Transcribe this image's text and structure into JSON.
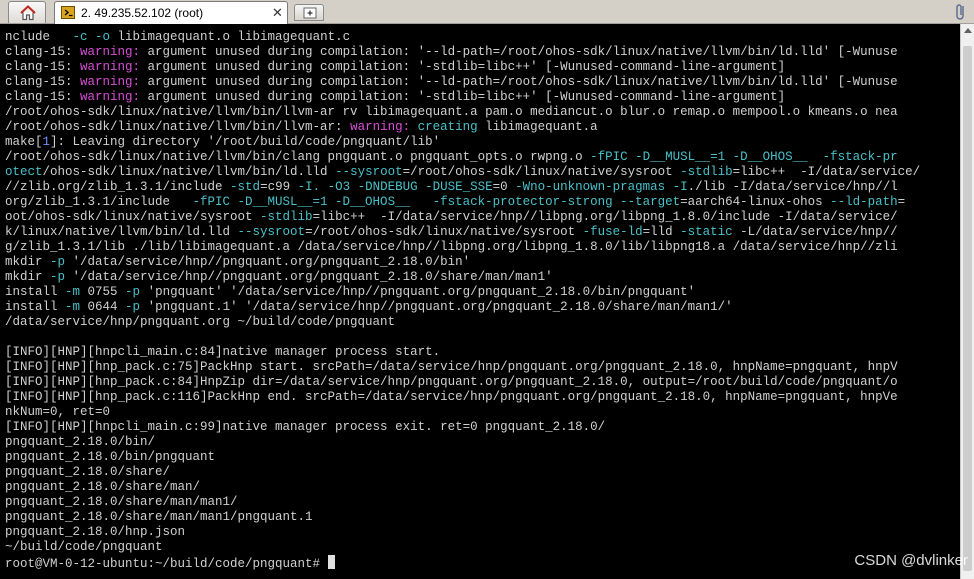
{
  "window": {
    "tab_title": "2. 49.235.52.102 (root)",
    "tab_close_glyph": "✕",
    "home_icon": "home-icon",
    "new_tab_icon": "new-tab-icon",
    "attach_icon": "paperclip-icon"
  },
  "colors": {
    "background": "#000000",
    "warning": "#d84ed6",
    "option": "#4ac0c8",
    "number": "#6f8cff",
    "text": "#d0d0d0"
  },
  "terminal": {
    "prompt": "root@VM-0-12-ubuntu:~/build/code/pngquant#",
    "lines": [
      [
        [
          "nclude   ",
          "n"
        ],
        [
          "-c -o",
          "c"
        ],
        [
          " libimagequant.o libimagequant.c",
          "n"
        ]
      ],
      [
        [
          "clang-15: ",
          "n"
        ],
        [
          "warning:",
          "w"
        ],
        [
          " argument unused during compilation: '--ld-path=/root/ohos-sdk/linux/native/llvm/bin/ld.lld' [-Wunuse",
          "n"
        ]
      ],
      [
        [
          "clang-15: ",
          "n"
        ],
        [
          "warning:",
          "w"
        ],
        [
          " argument unused during compilation: '-stdlib=libc++' [-Wunused-command-line-argument]",
          "n"
        ]
      ],
      [
        [
          "clang-15: ",
          "n"
        ],
        [
          "warning:",
          "w"
        ],
        [
          " argument unused during compilation: '--ld-path=/root/ohos-sdk/linux/native/llvm/bin/ld.lld' [-Wunuse",
          "n"
        ]
      ],
      [
        [
          "clang-15: ",
          "n"
        ],
        [
          "warning:",
          "w"
        ],
        [
          " argument unused during compilation: '-stdlib=libc++' [-Wunused-command-line-argument]",
          "n"
        ]
      ],
      [
        [
          "/root/ohos-sdk/linux/native/llvm/bin/llvm-ar rv libimagequant.a pam.o mediancut.o blur.o remap.o mempool.o kmeans.o nea",
          "n"
        ]
      ],
      [
        [
          "/root/ohos-sdk/linux/native/llvm/bin/llvm-ar: ",
          "n"
        ],
        [
          "warning:",
          "w"
        ],
        [
          " ",
          "n"
        ],
        [
          "creating",
          "c"
        ],
        [
          " libimagequant.a",
          "n"
        ]
      ],
      [
        [
          "make[",
          "n"
        ],
        [
          "1",
          "b"
        ],
        [
          "]: Leaving directory '/root/build/code/pngquant/lib'",
          "n"
        ]
      ],
      [
        [
          "/root/ohos-sdk/linux/native/llvm/bin/clang pngquant.o pngquant_opts.o rwpng.o ",
          "n"
        ],
        [
          "-fPIC -D__MUSL__=1 -D__OHOS__",
          "c"
        ],
        [
          "  -fstack-pr",
          "c"
        ]
      ],
      [
        [
          "otect",
          "c"
        ],
        [
          "/ohos-sdk/linux/native/llvm/bin/ld.lld ",
          "n"
        ],
        [
          "--sysroot",
          "c"
        ],
        [
          "=/root/ohos-sdk/linux/native/sysroot ",
          "n"
        ],
        [
          "-stdlib",
          "c"
        ],
        [
          "=libc++  -I/data/service/",
          "n"
        ]
      ],
      [
        [
          "//zlib.org/zlib_1.3.1/include ",
          "n"
        ],
        [
          "-std",
          "c"
        ],
        [
          "=c99 ",
          "n"
        ],
        [
          "-I. -O3 -DNDEBUG -DUSE_SSE",
          "c"
        ],
        [
          "=0 ",
          "n"
        ],
        [
          "-Wno-unknown-pragmas -I",
          "c"
        ],
        [
          "./lib -I/data/service/hnp//l",
          "n"
        ]
      ],
      [
        [
          "org/zlib_1.3.1/include   ",
          "n"
        ],
        [
          "-fPIC -D__MUSL__=1 -D__OHOS__   -fstack-protector-strong --target",
          "c"
        ],
        [
          "=aarch64-linux-ohos ",
          "n"
        ],
        [
          "--ld-path",
          "c"
        ],
        [
          "=",
          "n"
        ]
      ],
      [
        [
          "oot/ohos-sdk/linux/native/sysroot ",
          "n"
        ],
        [
          "-stdlib",
          "c"
        ],
        [
          "=libc++  -I/data/service/hnp//libpng.org/libpng_1.8.0/include -I/data/service/",
          "n"
        ]
      ],
      [
        [
          "k/linux/native/llvm/bin/ld.lld ",
          "n"
        ],
        [
          "--sysroot",
          "c"
        ],
        [
          "=/root/ohos-sdk/linux/native/sysroot ",
          "n"
        ],
        [
          "-fuse-ld",
          "c"
        ],
        [
          "=lld ",
          "n"
        ],
        [
          "-static",
          "c"
        ],
        [
          " -L/data/service/hnp//",
          "n"
        ]
      ],
      [
        [
          "g/zlib_1.3.1/lib ./lib/libimagequant.a /data/service/hnp//libpng.org/libpng_1.8.0/lib/libpng18.a /data/service/hnp//zli",
          "n"
        ]
      ],
      [
        [
          "mkdir ",
          "n"
        ],
        [
          "-p",
          "c"
        ],
        [
          " '/data/service/hnp//pngquant.org/pngquant_2.18.0/bin'",
          "n"
        ]
      ],
      [
        [
          "mkdir ",
          "n"
        ],
        [
          "-p",
          "c"
        ],
        [
          " '/data/service/hnp//pngquant.org/pngquant_2.18.0/share/man/man1'",
          "n"
        ]
      ],
      [
        [
          "install ",
          "n"
        ],
        [
          "-m",
          "c"
        ],
        [
          " 0755 ",
          "n"
        ],
        [
          "-p",
          "c"
        ],
        [
          " 'pngquant' '/data/service/hnp//pngquant.org/pngquant_2.18.0/bin/pngquant'",
          "n"
        ]
      ],
      [
        [
          "install ",
          "n"
        ],
        [
          "-m",
          "c"
        ],
        [
          " 0644 ",
          "n"
        ],
        [
          "-p",
          "c"
        ],
        [
          " 'pngquant.1' '/data/service/hnp//pngquant.org/pngquant_2.18.0/share/man/man1/'",
          "n"
        ]
      ],
      [
        [
          "/data/service/hnp/pngquant.org ~/build/code/pngquant",
          "n"
        ]
      ],
      [
        [
          "",
          "n"
        ]
      ],
      [
        [
          "[INFO][HNP][hnpcli_main.c:84]native manager process start.",
          "n"
        ]
      ],
      [
        [
          "[INFO][HNP][hnp_pack.c:75]PackHnp start. srcPath=/data/service/hnp/pngquant.org/pngquant_2.18.0, hnpName=pngquant, hnpV",
          "n"
        ]
      ],
      [
        [
          "[INFO][HNP][hnp_pack.c:84]HnpZip dir=/data/service/hnp/pngquant.org/pngquant_2.18.0, output=/root/build/code/pngquant/o",
          "n"
        ]
      ],
      [
        [
          "[INFO][HNP][hnp_pack.c:116]PackHnp end. srcPath=/data/service/hnp/pngquant.org/pngquant_2.18.0, hnpName=pngquant, hnpVe",
          "n"
        ]
      ],
      [
        [
          "nkNum=0, ret=0",
          "n"
        ]
      ],
      [
        [
          "[INFO][HNP][hnpcli_main.c:99]native manager process exit. ret=0 pngquant_2.18.0/",
          "n"
        ]
      ],
      [
        [
          "pngquant_2.18.0/bin/",
          "n"
        ]
      ],
      [
        [
          "pngquant_2.18.0/bin/pngquant",
          "n"
        ]
      ],
      [
        [
          "pngquant_2.18.0/share/",
          "n"
        ]
      ],
      [
        [
          "pngquant_2.18.0/share/man/",
          "n"
        ]
      ],
      [
        [
          "pngquant_2.18.0/share/man/man1/",
          "n"
        ]
      ],
      [
        [
          "pngquant_2.18.0/share/man/man1/pngquant.1",
          "n"
        ]
      ],
      [
        [
          "pngquant_2.18.0/hnp.json",
          "n"
        ]
      ],
      [
        [
          "~/build/code/pngquant",
          "n"
        ]
      ]
    ]
  },
  "watermark": "CSDN @dvlinker"
}
